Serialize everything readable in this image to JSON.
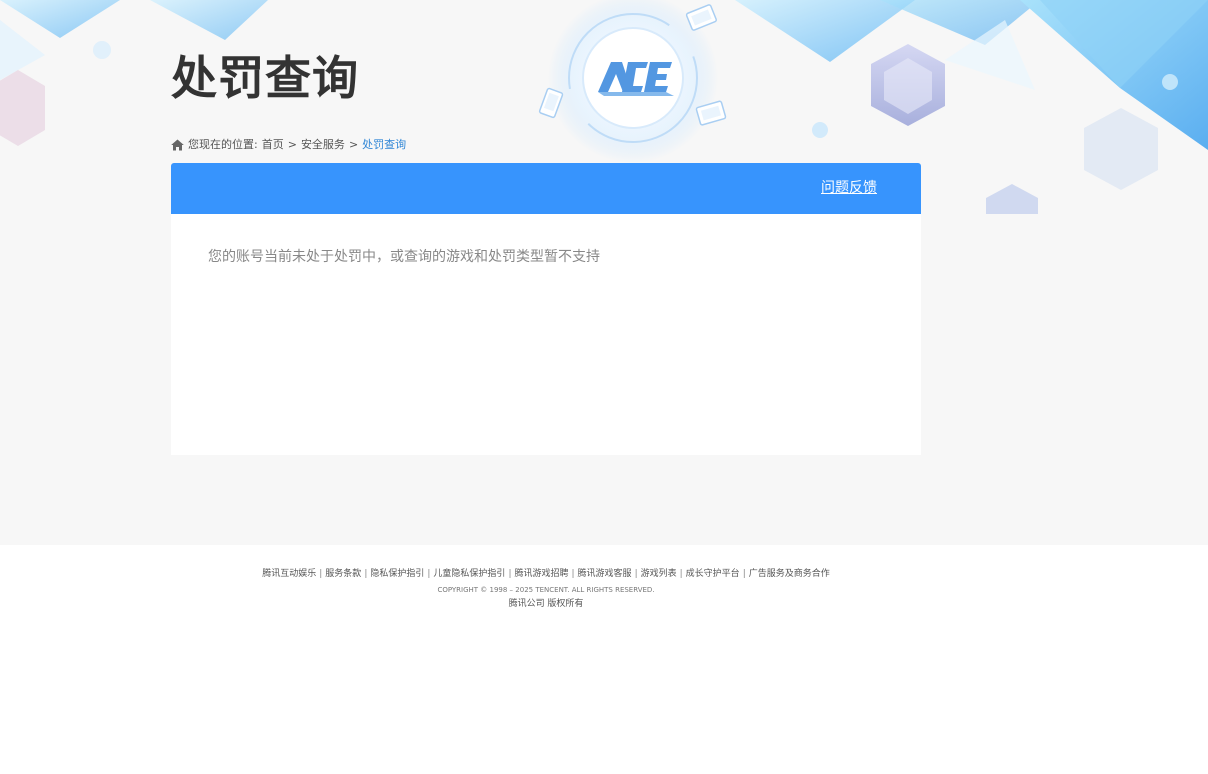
{
  "header": {
    "title": "处罚查询",
    "logo_text": "ACE"
  },
  "breadcrumb": {
    "prefix": "您现在的位置:",
    "items": [
      {
        "label": "首页"
      },
      {
        "label": "安全服务"
      },
      {
        "label": "处罚查询"
      }
    ],
    "separator": ">"
  },
  "panel": {
    "feedback_label": "问题反馈",
    "message": "您的账号当前未处于处罚中，或查询的游戏和处罚类型暂不支持"
  },
  "footer": {
    "links": [
      {
        "label": "腾讯互动娱乐"
      },
      {
        "label": "服务条款"
      },
      {
        "label": "隐私保护指引"
      },
      {
        "label": "儿童隐私保护指引"
      },
      {
        "label": "腾讯游戏招聘"
      },
      {
        "label": "腾讯游戏客服"
      },
      {
        "label": "游戏列表"
      },
      {
        "label": "成长守护平台"
      },
      {
        "label": "广告服务及商务合作"
      }
    ],
    "link_separator": "|",
    "copyright": "COPYRIGHT © 1998 – 2025 TENCENT. ALL RIGHTS RESERVED.",
    "rights": "腾讯公司 版权所有"
  },
  "colors": {
    "accent": "#3794fd",
    "page_background": "#f7f7f7",
    "breadcrumb_current": "#2f86d6"
  },
  "icons": {
    "breadcrumb_home": "home-icon",
    "logo": "ace-logo"
  }
}
